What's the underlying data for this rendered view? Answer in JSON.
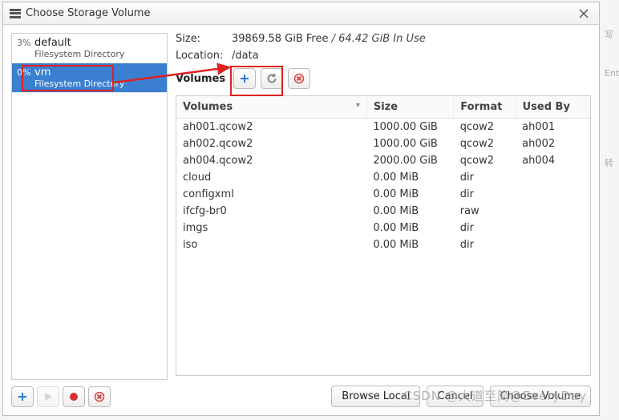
{
  "window": {
    "title": "Choose Storage Volume"
  },
  "pools": [
    {
      "pct": "3%",
      "name": "default",
      "sub": "Filesystem Directory",
      "selected": false
    },
    {
      "pct": "0%",
      "name": "vm",
      "sub": "Filesystem Directory",
      "selected": true
    }
  ],
  "info": {
    "size_label": "Size:",
    "size_free": "39869.58 GiB Free",
    "size_sep": " / ",
    "size_used": "64.42 GiB In Use",
    "loc_label": "Location:",
    "loc_value": "/data"
  },
  "volumes_label": "Volumes",
  "table": {
    "headers": {
      "vol": "Volumes",
      "size": "Size",
      "format": "Format",
      "used": "Used By"
    },
    "rows": [
      {
        "vol": "ah001.qcow2",
        "size": "1000.00 GiB",
        "format": "qcow2",
        "used": "ah001"
      },
      {
        "vol": "ah002.qcow2",
        "size": "1000.00 GiB",
        "format": "qcow2",
        "used": "ah002"
      },
      {
        "vol": "ah004.qcow2",
        "size": "2000.00 GiB",
        "format": "qcow2",
        "used": "ah004"
      },
      {
        "vol": "cloud",
        "size": "0.00 MiB",
        "format": "dir",
        "used": ""
      },
      {
        "vol": "configxml",
        "size": "0.00 MiB",
        "format": "dir",
        "used": ""
      },
      {
        "vol": "ifcfg-br0",
        "size": "0.00 MiB",
        "format": "raw",
        "used": ""
      },
      {
        "vol": "imgs",
        "size": "0.00 MiB",
        "format": "dir",
        "used": ""
      },
      {
        "vol": "iso",
        "size": "0.00 MiB",
        "format": "dir",
        "used": ""
      }
    ]
  },
  "footer": {
    "browse": "Browse Local",
    "cancel": "Cancel",
    "choose": "Choose Volume"
  },
  "rightstrip": {
    "a": "写",
    "b": "Ent",
    "c": "转"
  },
  "watermark": "CSDN @大道至简@EveryDay"
}
